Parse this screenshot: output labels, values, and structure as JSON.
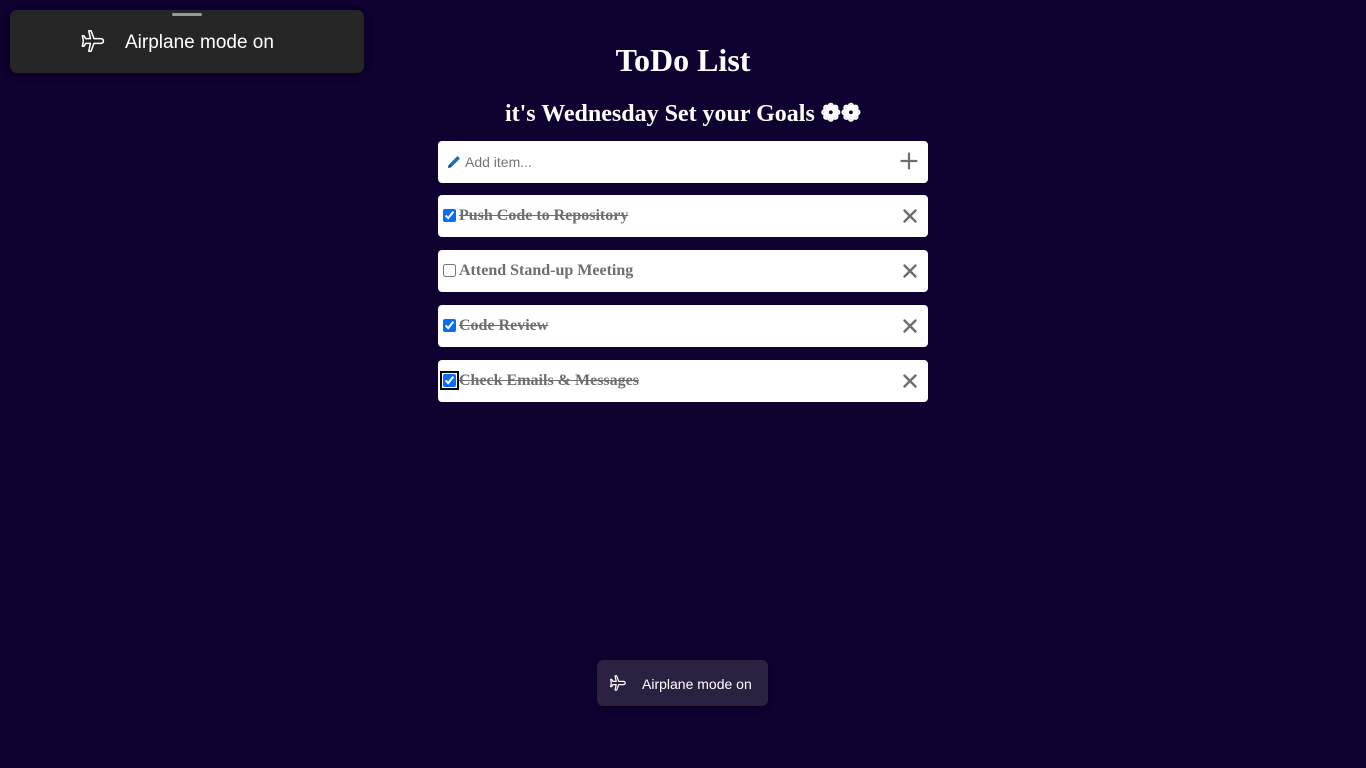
{
  "toast_top": {
    "text": "Airplane mode on",
    "icon": "airplane-icon"
  },
  "header": {
    "title": "ToDo List",
    "subtitle": "it's Wednesday Set your Goals ❁❁"
  },
  "add_item": {
    "placeholder": "Add item...",
    "icon": "pencil-icon",
    "button_icon": "plus-icon"
  },
  "todos": [
    {
      "text": "Push Code to Repository",
      "done": true
    },
    {
      "text": "Attend Stand-up Meeting",
      "done": false
    },
    {
      "text": "Code Review",
      "done": true
    },
    {
      "text": "Check Emails & Messages",
      "done": true
    }
  ],
  "toast_bottom": {
    "text": "Airplane mode on",
    "icon": "airplane-icon"
  },
  "colors": {
    "background": "#0f0130",
    "checkbox_accent": "#0a6cf5",
    "item_text": "#6e6e6e",
    "pencil": "#1a6fb5"
  }
}
